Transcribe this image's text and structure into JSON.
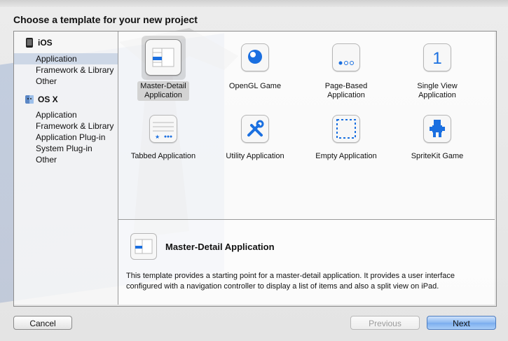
{
  "dialog": {
    "title": "Choose a template for your new project"
  },
  "sidebar": {
    "sections": [
      {
        "label": "iOS",
        "items": [
          "Application",
          "Framework & Library",
          "Other"
        ]
      },
      {
        "label": "OS X",
        "items": [
          "Application",
          "Framework & Library",
          "Application Plug-in",
          "System Plug-in",
          "Other"
        ]
      }
    ],
    "selected": "iOS / Application"
  },
  "templates": [
    {
      "label_line1": "Master-Detail",
      "label_line2": "Application",
      "icon": "master-detail-icon",
      "selected": true
    },
    {
      "label_line1": "OpenGL Game",
      "label_line2": "",
      "icon": "opengl-game-icon",
      "selected": false
    },
    {
      "label_line1": "Page-Based",
      "label_line2": "Application",
      "icon": "page-based-icon",
      "selected": false
    },
    {
      "label_line1": "Single View",
      "label_line2": "Application",
      "icon": "single-view-icon",
      "selected": false
    },
    {
      "label_line1": "Tabbed Application",
      "label_line2": "",
      "icon": "tabbed-icon",
      "selected": false
    },
    {
      "label_line1": "Utility Application",
      "label_line2": "",
      "icon": "utility-icon",
      "selected": false
    },
    {
      "label_line1": "Empty Application",
      "label_line2": "",
      "icon": "empty-icon",
      "selected": false
    },
    {
      "label_line1": "SpriteKit Game",
      "label_line2": "",
      "icon": "spritekit-icon",
      "selected": false
    }
  ],
  "detail": {
    "title": "Master-Detail Application",
    "description": "This template provides a starting point for a master-detail application. It provides a user interface configured with a navigation controller to display a list of items and also a split view on iPad."
  },
  "buttons": {
    "cancel": "Cancel",
    "previous": "Previous",
    "next": "Next"
  },
  "colors": {
    "accent": "#1a6fe0",
    "selection": "#cdd7e6"
  }
}
